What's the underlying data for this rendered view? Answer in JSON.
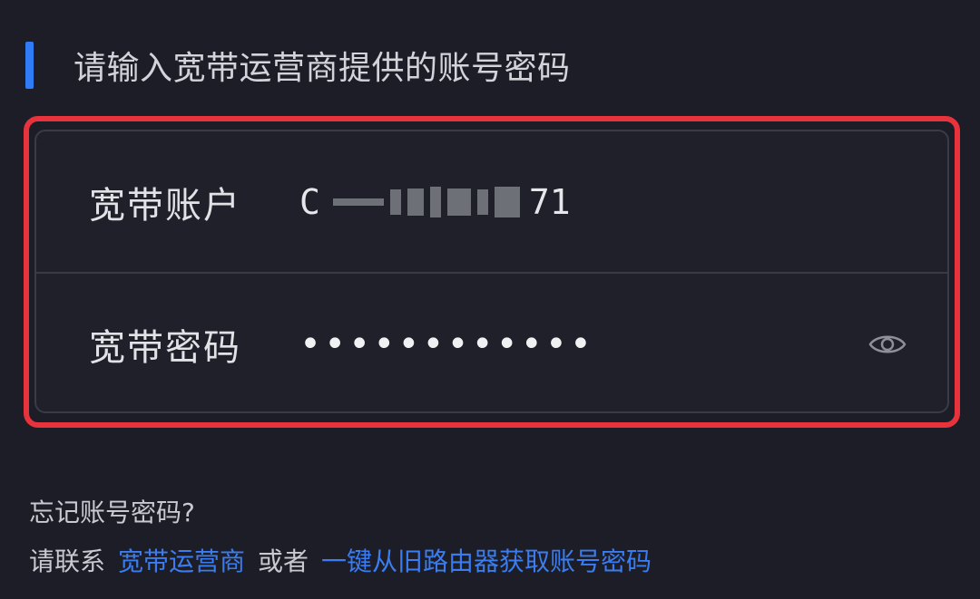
{
  "section": {
    "title": "请输入宽带运营商提供的账号密码",
    "accent_color": "#2f7cf6"
  },
  "highlight": {
    "color": "#e8323c"
  },
  "form": {
    "account": {
      "label": "宽带账户",
      "value_prefix": "C",
      "value_suffix": "71",
      "masked": true
    },
    "password": {
      "label": "宽带密码",
      "value_display": "••••••••••••",
      "visibility_icon": "eye-icon"
    }
  },
  "help": {
    "question": "忘记账号密码?",
    "prefix": "请联系",
    "link_isp": "宽带运营商",
    "connector": "或者",
    "link_retrieve": "一键从旧路由器获取账号密码",
    "link_color": "#3a7df0"
  }
}
